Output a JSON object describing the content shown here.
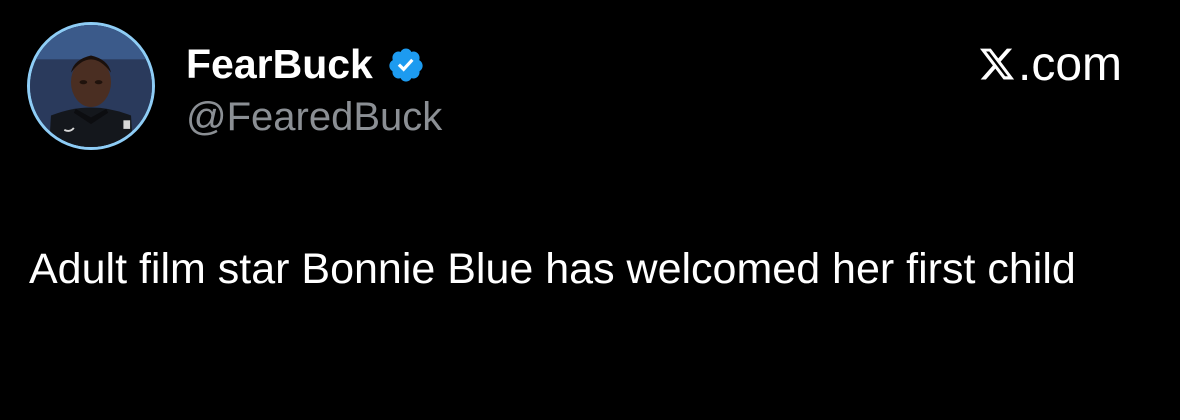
{
  "author": {
    "display_name": "FearBuck",
    "handle": "@FearedBuck",
    "verified": true
  },
  "brand": {
    "label": ".com",
    "icon": "x-logo-icon"
  },
  "tweet": {
    "text": "Adult film star Bonnie Blue has welcomed her first child"
  },
  "colors": {
    "background": "#000000",
    "name": "#ffffff",
    "handle": "#8b8f94",
    "verified": "#1d9bf0",
    "avatar_ring": "#8ecdf6"
  }
}
